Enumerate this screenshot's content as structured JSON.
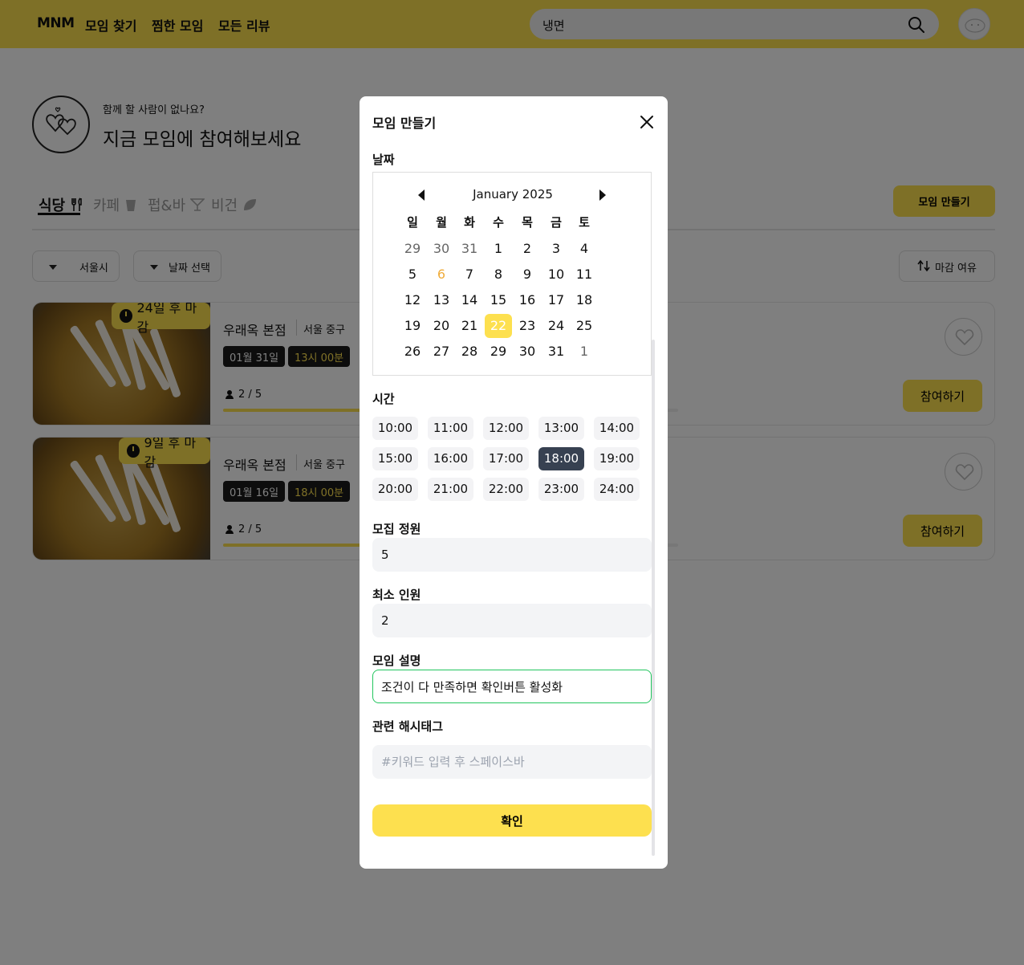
{
  "header": {
    "logo": "MNM",
    "nav": [
      "모임 찾기",
      "찜한 모임",
      "모든 리뷰"
    ],
    "search_value": "냉면"
  },
  "hero": {
    "small_text": "함께 할 사람이 없나요?",
    "big_text": "지금 모임에 참여해보세요"
  },
  "tabs": [
    {
      "label": "식당",
      "icon": "fork-knife-icon"
    },
    {
      "label": "카페",
      "icon": "cup-icon"
    },
    {
      "label": "펍&바",
      "icon": "cocktail-icon"
    },
    {
      "label": "비건",
      "icon": "leaf-icon"
    }
  ],
  "create_button": "모임 만들기",
  "filters": {
    "region": "서울시",
    "date": "날짜 선택",
    "sort": "마감 여유"
  },
  "cards": [
    {
      "deadline": "24일 후 마감",
      "place": "우래옥 본점",
      "district": "서울 중구",
      "date": "01월 31일",
      "time": "13시 00분",
      "people": "2 / 5",
      "progress": 0.4,
      "join": "참여하기"
    },
    {
      "deadline": "9일 후 마감",
      "place": "우래옥 본점",
      "district": "서울 중구",
      "date": "01월 16일",
      "time": "18시 00분",
      "people": "2 / 5",
      "progress": 0.4,
      "join": "참여하기"
    }
  ],
  "modal": {
    "title": "모임 만들기",
    "date_label": "날짜",
    "calendar": {
      "month": "January 2025",
      "weekdays": [
        "일",
        "월",
        "화",
        "수",
        "목",
        "금",
        "토"
      ],
      "weeks": [
        [
          "29",
          "30",
          "31",
          "1",
          "2",
          "3",
          "4"
        ],
        [
          "5",
          "6",
          "7",
          "8",
          "9",
          "10",
          "11"
        ],
        [
          "12",
          "13",
          "14",
          "15",
          "16",
          "17",
          "18"
        ],
        [
          "19",
          "20",
          "21",
          "22",
          "23",
          "24",
          "25"
        ],
        [
          "26",
          "27",
          "28",
          "29",
          "30",
          "31",
          "1"
        ]
      ],
      "today": "6",
      "selected": "22"
    },
    "time_label": "시간",
    "times": [
      "10:00",
      "11:00",
      "12:00",
      "13:00",
      "14:00",
      "15:00",
      "16:00",
      "17:00",
      "18:00",
      "19:00",
      "20:00",
      "21:00",
      "22:00",
      "23:00",
      "24:00"
    ],
    "selected_time": "18:00",
    "capacity_label": "모집 정원",
    "capacity_value": "5",
    "min_label": "최소 인원",
    "min_value": "2",
    "desc_label": "모임 설명",
    "desc_value": "조건이 다 만족하면 확인버튼 활성화",
    "hashtag_label": "관련 해시태그",
    "hashtag_placeholder": "#키워드 입력 후 스페이스바",
    "confirm": "확인"
  }
}
